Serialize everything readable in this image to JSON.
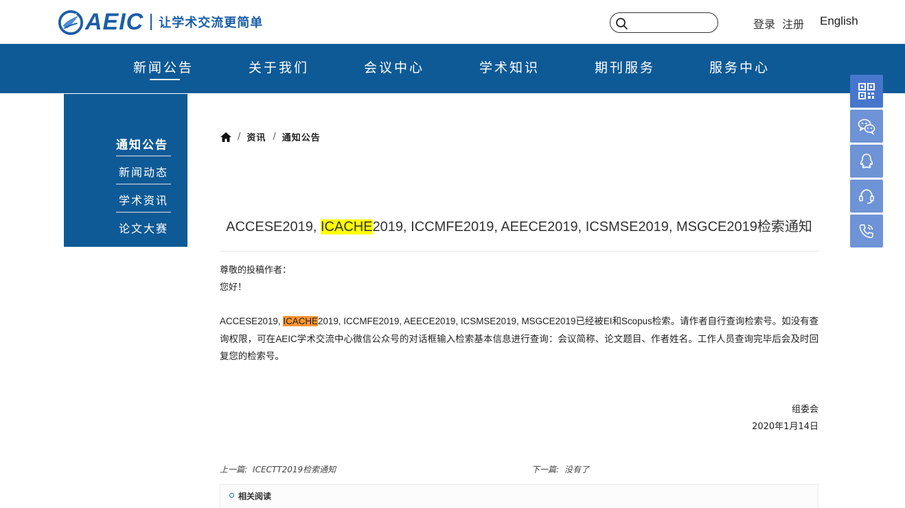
{
  "header": {
    "logo_text": "AEIC",
    "slogan": "让学术交流更简单",
    "search": {
      "placeholder": "",
      "value": ""
    },
    "login_label": "登录",
    "register_label": "注册",
    "language_label": "English"
  },
  "nav": {
    "items": [
      {
        "label": "新闻公告",
        "active": true
      },
      {
        "label": "关于我们"
      },
      {
        "label": "会议中心"
      },
      {
        "label": "学术知识"
      },
      {
        "label": "期刊服务"
      },
      {
        "label": "服务中心"
      }
    ]
  },
  "sidebar": {
    "title": "通知公告",
    "items": [
      {
        "label": "新闻动态"
      },
      {
        "label": "学术资讯"
      },
      {
        "label": "论文大赛"
      }
    ]
  },
  "breadcrumb": {
    "home_icon": "home-icon",
    "items": [
      "资讯",
      "通知公告"
    ],
    "separator": "/"
  },
  "article": {
    "title_prefix": "ACCESE2019, ",
    "title_highlight": "ICACHE",
    "title_suffix": "2019, ICCMFE2019, AEECE2019, ICSMSE2019, MSGCE2019检索通知",
    "greeting_line1": "尊敬的投稿作者：",
    "greeting_line2": "您好！",
    "body_prefix": "ACCESE2019, ",
    "body_highlight": "ICACHE",
    "body_suffix": "2019, ICCMFE2019, AEECE2019, ICSMSE2019, MSGCE2019已经被EI和Scopus检索。请作者自行查询检索号。如没有查询权限，可在AEIC学术交流中心微信公众号的对话框输入检索基本信息进行查询：会议简称、论文题目、作者姓名。工作人员查询完毕后会及时回复您的检索号。",
    "signature": "组委会",
    "date": "2020年1月14日"
  },
  "pagination": {
    "prev_label": "上一篇:",
    "prev_value": "ICECTT2019检索通知",
    "next_label": "下一篇:",
    "next_value": "没有了"
  },
  "related": {
    "label": "相关阅读"
  },
  "floating_tools": [
    {
      "icon": "qr-code-icon"
    },
    {
      "icon": "wechat-icon"
    },
    {
      "icon": "qq-icon"
    },
    {
      "icon": "customer-service-icon"
    },
    {
      "icon": "phone-icon"
    }
  ],
  "colors": {
    "primary": "#0e5a96",
    "logo_blue": "#1a5ea8",
    "float_button": "#6e93d6",
    "float_button_active": "#4677cc",
    "highlight_yellow": "#ffff00",
    "highlight_orange": "#ff9632"
  }
}
